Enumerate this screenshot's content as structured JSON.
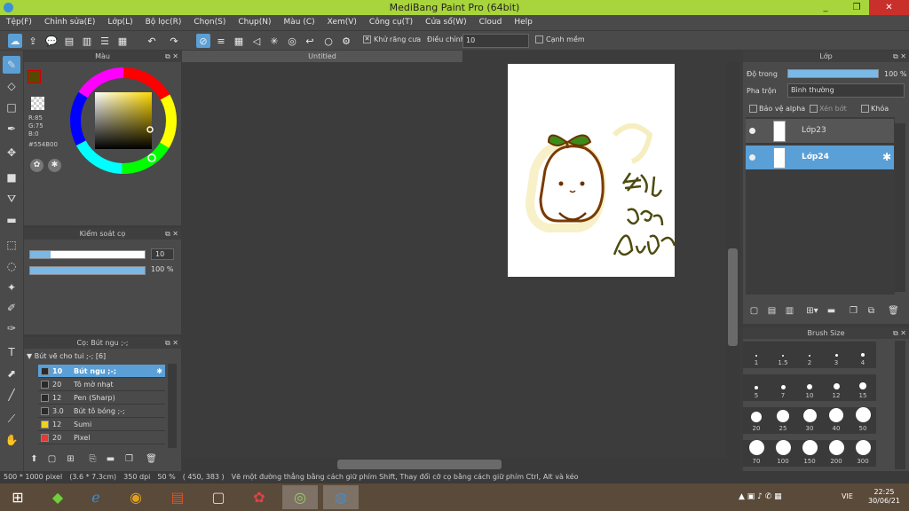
{
  "window": {
    "title": "MediBang Paint Pro (64bit)",
    "minimize": "_",
    "maximize": "❐",
    "close": "✕"
  },
  "menu": [
    "Tệp(F)",
    "Chỉnh sửa(E)",
    "Lớp(L)",
    "Bộ lọc(R)",
    "Chọn(S)",
    "Chụp(N)",
    "Màu (C)",
    "Xem(V)",
    "Công cụ(T)",
    "Cửa sổ(W)",
    "Cloud",
    "Help"
  ],
  "toolbar": {
    "antialias_label": "Khử răng cưa",
    "adjust_label": "Điều chỉnh",
    "adjust_value": "10",
    "smooth_label": "Cạnh mềm",
    "check_mark": "✕"
  },
  "document": {
    "tab_title": "Untitled"
  },
  "color_panel": {
    "title": "Màu",
    "main_color": "#554B00",
    "r": "R:85",
    "g": "G:75",
    "b": "B:0",
    "hex": "#554B00"
  },
  "brush_control": {
    "title": "Kiểm soát cọ",
    "size_value": "10",
    "size_fill": 0.18,
    "opacity_value": "100 %",
    "opacity_fill": 1.0
  },
  "brush_panel": {
    "title": "Cọ: Bút ngu ;-;",
    "group_label": "Bút vẽ cho tui ;-; [6]",
    "brushes": [
      {
        "size": "10",
        "name": "Bút ngu ;-;",
        "color": "#2a2a2a",
        "active": true
      },
      {
        "size": "20",
        "name": "Tô mờ nhạt",
        "color": "#2a2a2a",
        "active": false
      },
      {
        "size": "12",
        "name": "Pen (Sharp)",
        "color": "#2a2a2a",
        "active": false
      },
      {
        "size": "3.0",
        "name": "Bút tô bóng ;-;",
        "color": "#2a2a2a",
        "active": false
      },
      {
        "size": "12",
        "name": "Sumi",
        "color": "#f2d21c",
        "active": false
      },
      {
        "size": "20",
        "name": "Pixel",
        "color": "#e53935",
        "active": false
      }
    ]
  },
  "layer_panel": {
    "title": "Lớp",
    "opacity_label": "Độ trong",
    "opacity_value": "100 %",
    "blend_label": "Pha trộn",
    "blend_value": "Bình thường",
    "protect_alpha": "Bảo vệ alpha",
    "clipping": "Xén bớt",
    "lock": "Khóa",
    "layers": [
      {
        "name": "Lớp23",
        "active": false
      },
      {
        "name": "Lớp24",
        "active": true
      }
    ]
  },
  "brush_size_panel": {
    "title": "Brush Size",
    "sizes": [
      "1",
      "1.5",
      "2",
      "3",
      "4",
      "5",
      "7",
      "10",
      "12",
      "15",
      "20",
      "25",
      "30",
      "40",
      "50",
      "70",
      "100",
      "150",
      "200",
      "300"
    ]
  },
  "status": {
    "dimensions": "500 * 1000 pixel",
    "physical": "(3.6 * 7.3cm)",
    "dpi": "350 dpi",
    "zoom": "50 %",
    "coords": "( 450, 383 )",
    "hint": "Vẽ một đường thẳng bằng cách giữ phím Shift, Thay đổi cỡ cọ bằng cách giữ phím Ctrl, Alt và kéo"
  },
  "taskbar": {
    "lang": "VIE",
    "time": "22:25",
    "date": "30/06/21"
  }
}
